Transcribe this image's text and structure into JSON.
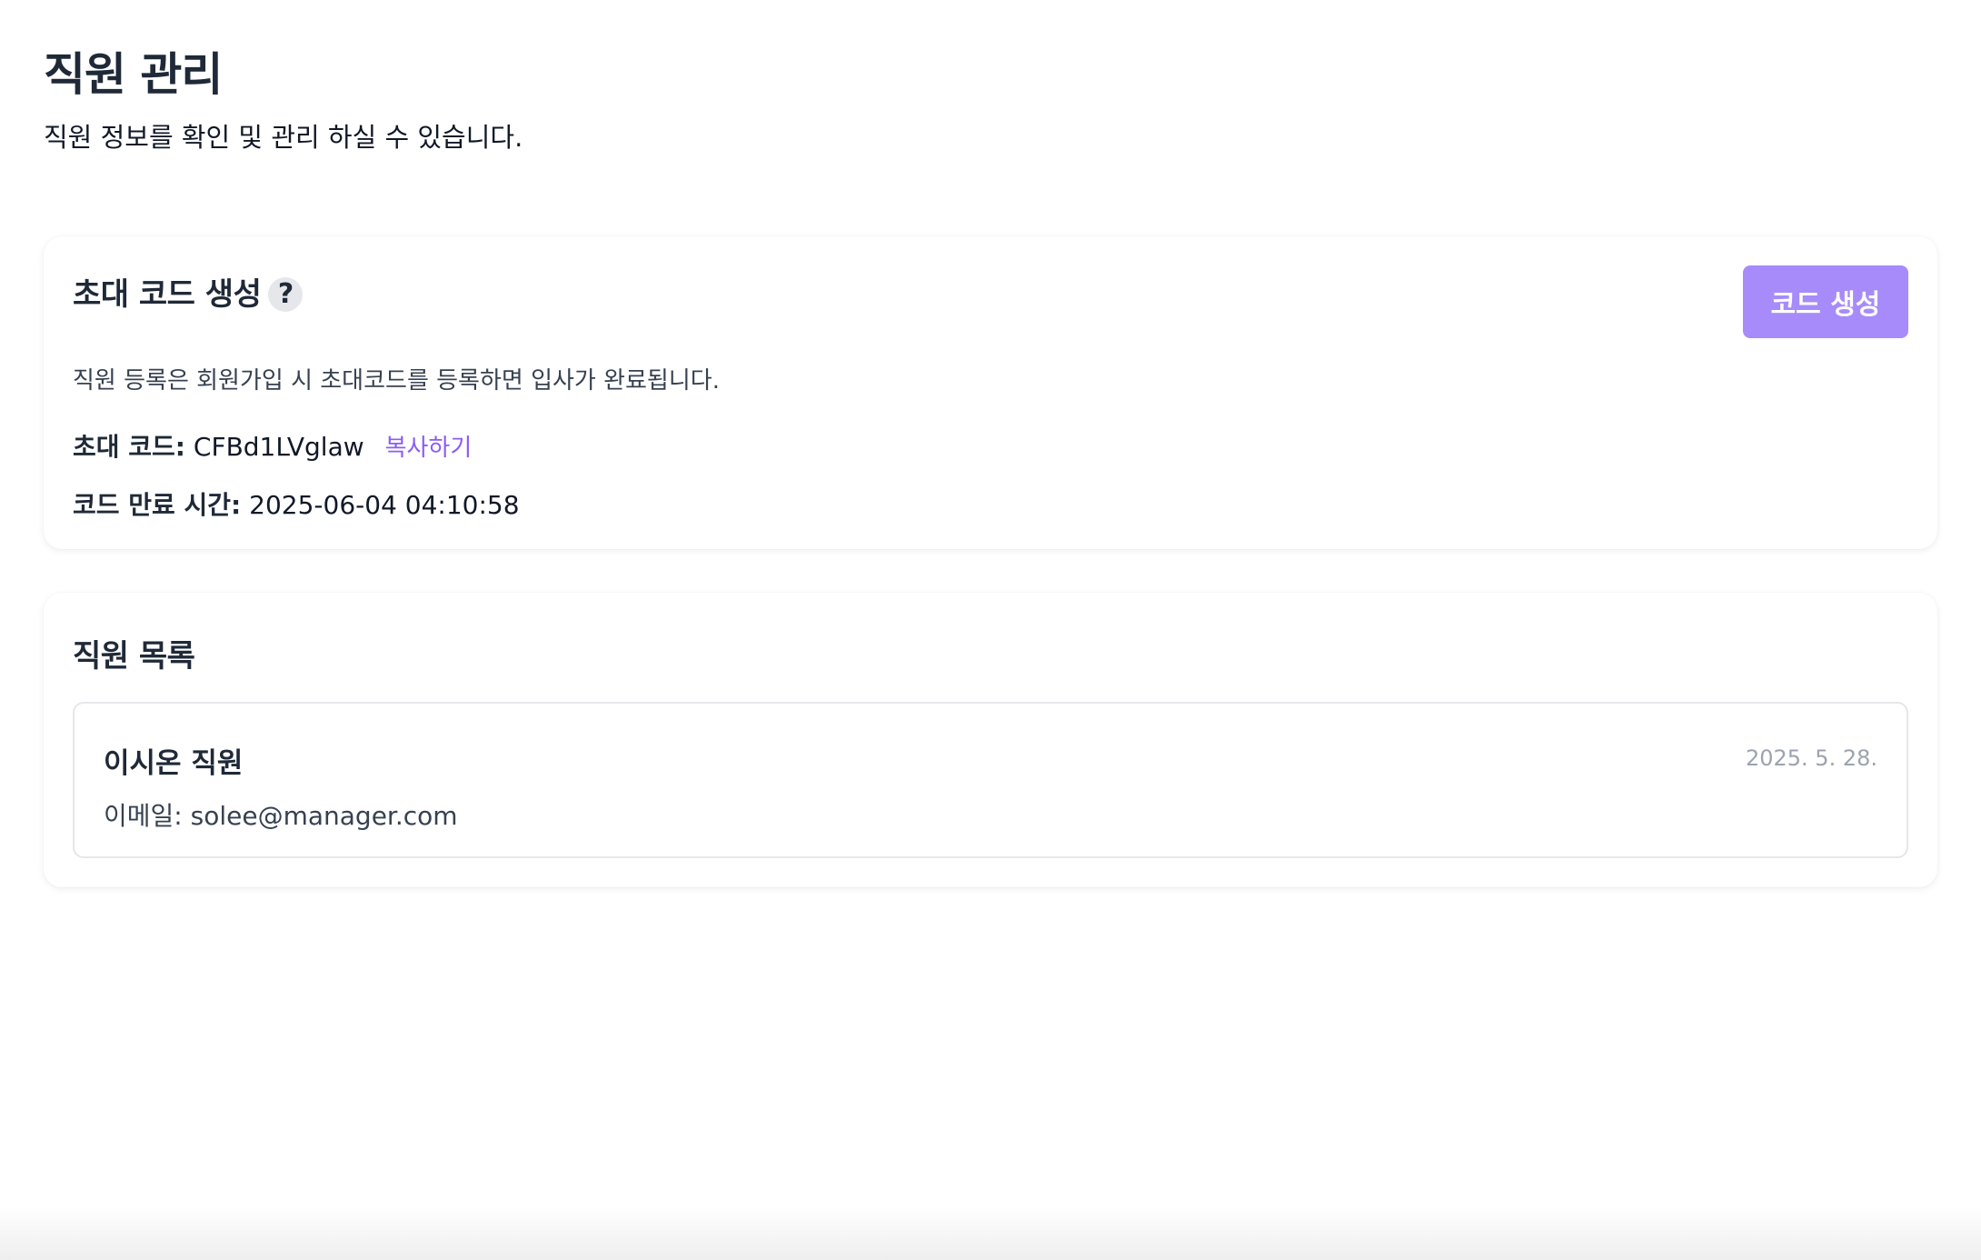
{
  "header": {
    "title": "직원 관리",
    "subtitle": "직원 정보를 확인 및 관리 하실 수 있습니다."
  },
  "invite": {
    "title": "초대 코드 생성",
    "help_icon": "question-icon",
    "help_symbol": "?",
    "generate_label": "코드 생성",
    "description": "직원 등록은 회원가입 시 초대코드를 등록하면 입사가 완료됩니다.",
    "code_label": "초대 코드:",
    "code_value": "CFBd1LVglaw",
    "copy_label": "복사하기",
    "expire_label": "코드 만료 시간:",
    "expire_value": "2025-06-04 04:10:58"
  },
  "staff": {
    "title": "직원 목록",
    "items": [
      {
        "name": "이시온 직원",
        "date": "2025. 5. 28.",
        "email_label": "이메일:",
        "email": "solee@manager.com"
      }
    ]
  },
  "colors": {
    "accent": "#a78bfa",
    "link": "#8b5cf6",
    "text": "#1f2937",
    "muted": "#9ca3af"
  }
}
